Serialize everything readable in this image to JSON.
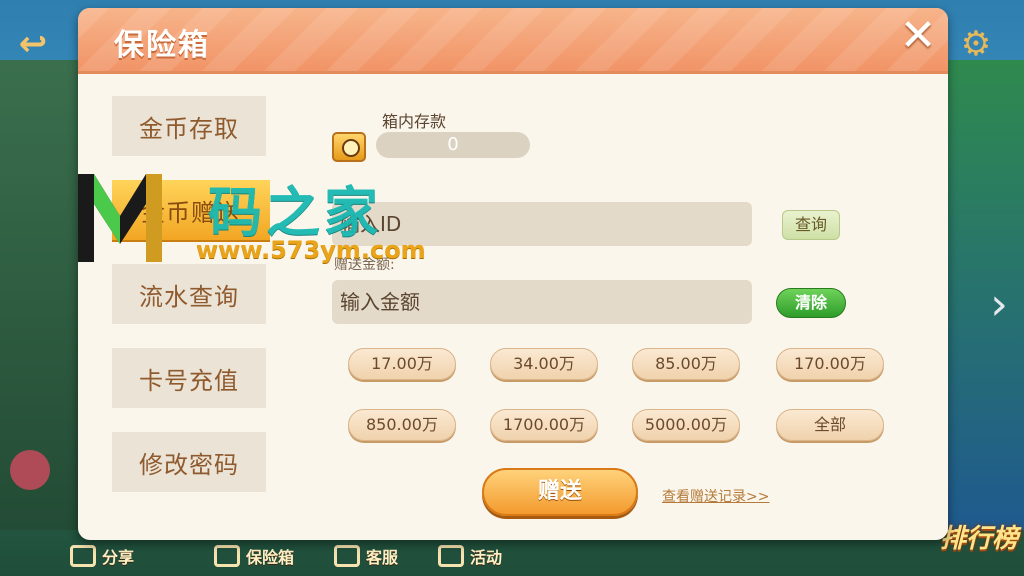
{
  "dialog": {
    "title": "保险箱",
    "close_icon": "close-icon"
  },
  "side_menu": [
    {
      "label": "金币存取",
      "active": false
    },
    {
      "label": "金币赠送",
      "active": true
    },
    {
      "label": "流水查询",
      "active": false
    },
    {
      "label": "卡号充值",
      "active": false
    },
    {
      "label": "修改密码",
      "active": false
    }
  ],
  "safe": {
    "label": "箱内存款",
    "balance": "0"
  },
  "account_field": {
    "placeholder": "输入ID"
  },
  "query_button": "查询",
  "amount": {
    "label": "赠送金额:",
    "placeholder": "输入金额"
  },
  "clear_button": "清除",
  "amount_options": [
    "17.00万",
    "34.00万",
    "85.00万",
    "170.00万",
    "850.00万",
    "1700.00万",
    "5000.00万",
    "全部"
  ],
  "gift_button": "赠送",
  "record_link": "查看赠送记录>>",
  "bottom_bar": [
    {
      "label": "分享"
    },
    {
      "label": "保险箱"
    },
    {
      "label": "客服"
    },
    {
      "label": "活动"
    }
  ],
  "rank_label": "排行榜",
  "watermark": {
    "title": "码之家",
    "url": "www.573ym.com"
  },
  "colors": {
    "header": "#f19467",
    "active_menu": "#f2a623",
    "clear_green": "#2e9c2a",
    "gift_orange": "#f39a2e",
    "watermark_teal": "#19b8b2"
  }
}
